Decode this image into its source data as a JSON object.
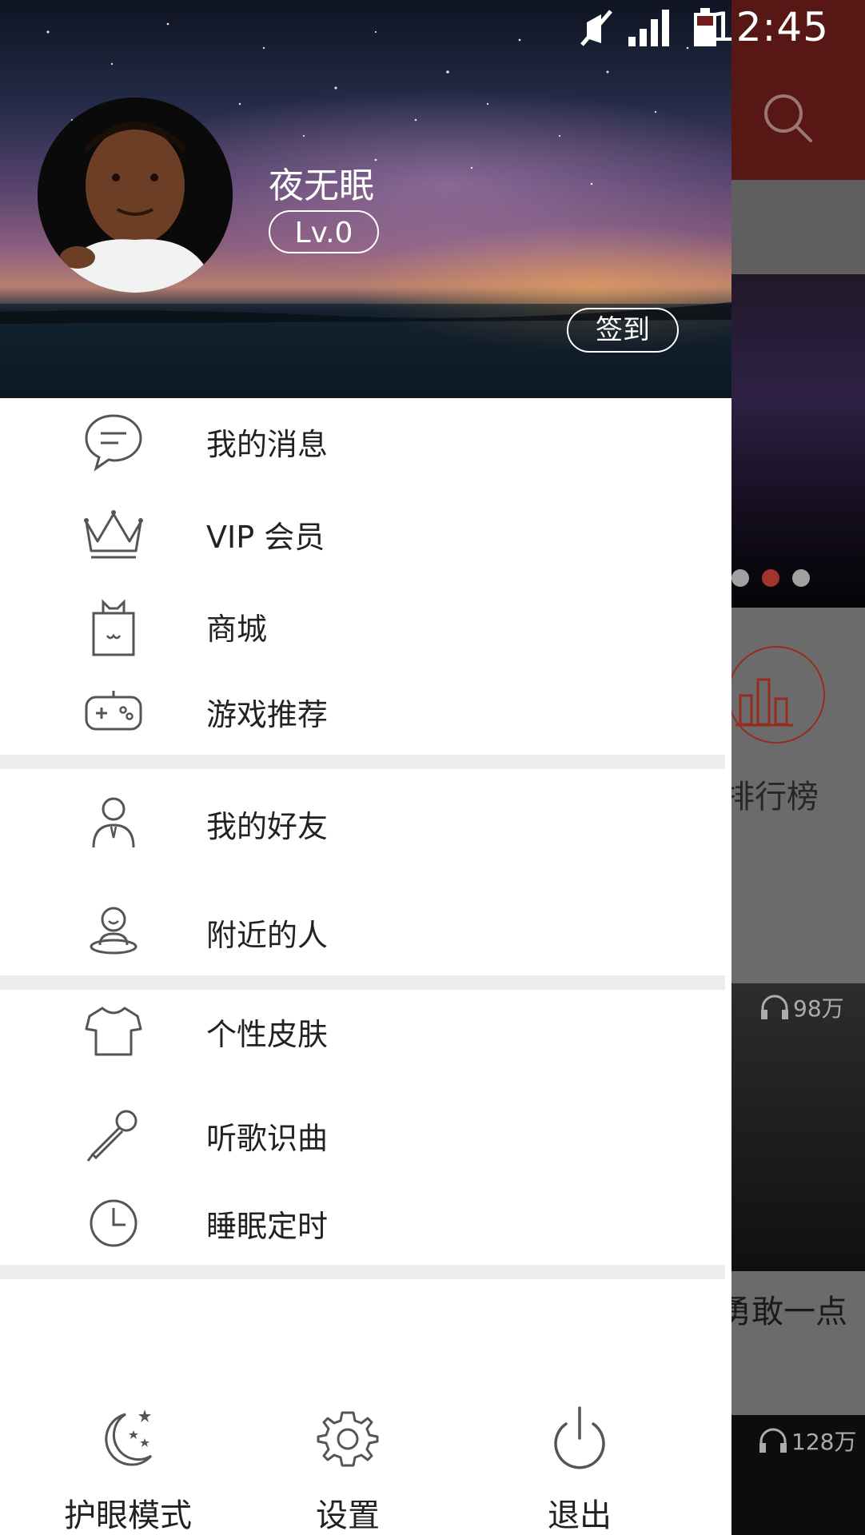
{
  "status_bar": {
    "time": "12:45",
    "icons": [
      "mute-icon",
      "signal-icon",
      "battery-icon"
    ]
  },
  "drawer": {
    "profile": {
      "username": "夜无眠",
      "level": "Lv.0",
      "signin_label": "签到"
    },
    "menu_groups": [
      [
        {
          "label": "我的消息",
          "icon": "chat-bubble-icon"
        },
        {
          "label": "VIP 会员",
          "icon": "crown-icon"
        },
        {
          "label": "商城",
          "icon": "shopping-bag-icon"
        },
        {
          "label": "游戏推荐",
          "icon": "gamepad-icon"
        }
      ],
      [
        {
          "label": "我的好友",
          "icon": "friend-person-icon"
        },
        {
          "label": "附近的人",
          "icon": "nearby-person-icon"
        }
      ],
      [
        {
          "label": "个性皮肤",
          "icon": "tshirt-icon"
        },
        {
          "label": "听歌识曲",
          "icon": "microphone-icon"
        },
        {
          "label": "睡眠定时",
          "icon": "clock-icon"
        }
      ]
    ],
    "footer": {
      "eye_mode_label": "护眼模式",
      "settings_label": "设置",
      "logout_label": "退出"
    }
  },
  "background": {
    "rank_label": "排行榜",
    "card1_play_count": "98万",
    "card1_title": "勇敢一点",
    "card2_play_count": "128万",
    "banner_dots": 3,
    "active_dot": 1
  },
  "colors": {
    "accent": "#c0392b",
    "topbar": "#6f1e1b",
    "divider": "#ececec"
  }
}
